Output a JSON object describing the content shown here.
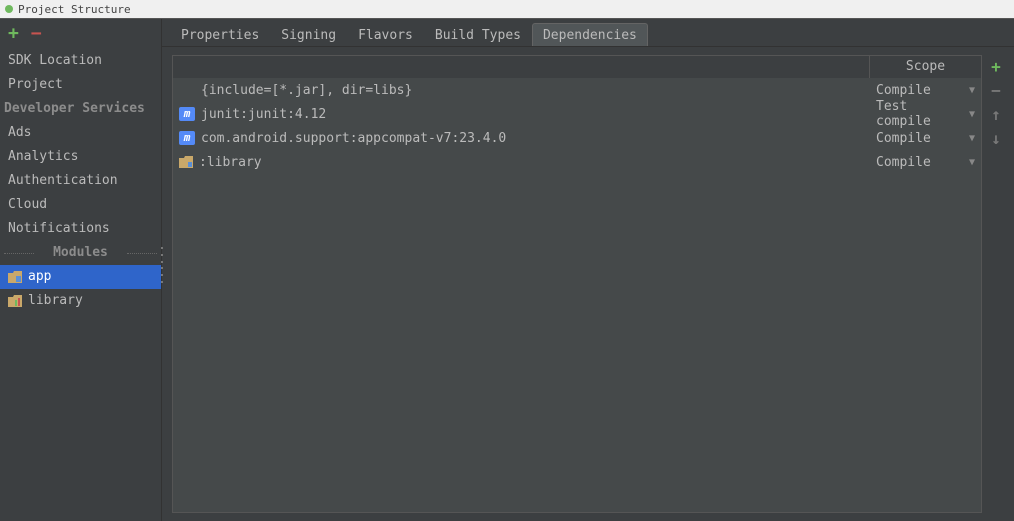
{
  "window": {
    "title": "Project Structure"
  },
  "sidebar": {
    "items": [
      "SDK Location",
      "Project"
    ],
    "devservices_title": "Developer Services",
    "devservices": [
      "Ads",
      "Analytics",
      "Authentication",
      "Cloud",
      "Notifications"
    ],
    "modules_title": "Modules",
    "modules": [
      {
        "name": "app",
        "selected": true
      },
      {
        "name": "library",
        "selected": false
      }
    ]
  },
  "tabs": {
    "items": [
      {
        "label": "Properties",
        "active": false
      },
      {
        "label": "Signing",
        "active": false
      },
      {
        "label": "Flavors",
        "active": false
      },
      {
        "label": "Build Types",
        "active": false
      },
      {
        "label": "Dependencies",
        "active": true
      }
    ]
  },
  "deps": {
    "scope_header": "Scope",
    "rows": [
      {
        "icon": "none",
        "name": "{include=[*.jar], dir=libs}",
        "scope": "Compile"
      },
      {
        "icon": "maven",
        "name": "junit:junit:4.12",
        "scope": "Test compile"
      },
      {
        "icon": "maven",
        "name": "com.android.support:appcompat-v7:23.4.0",
        "scope": "Compile"
      },
      {
        "icon": "module",
        "name": ":library",
        "scope": "Compile"
      }
    ]
  }
}
